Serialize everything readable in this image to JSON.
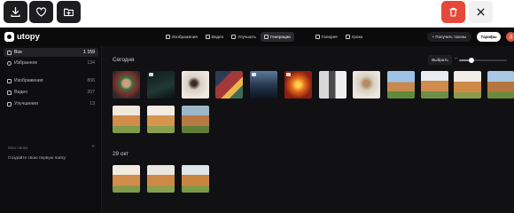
{
  "toolbar": {
    "buttons": [
      {
        "name": "download-button",
        "icon": "download-icon"
      },
      {
        "name": "favorite-button",
        "icon": "heart-icon"
      },
      {
        "name": "add-to-folder-button",
        "icon": "folder-plus-icon"
      },
      {
        "name": "delete-button",
        "icon": "trash-icon"
      },
      {
        "name": "close-button",
        "icon": "close-icon"
      }
    ]
  },
  "header": {
    "logo": "utopy",
    "nav": [
      {
        "label": "Изображения",
        "icon": "image-icon",
        "active": false
      },
      {
        "label": "Видео",
        "icon": "video-icon",
        "active": false
      },
      {
        "label": "Улучшить",
        "icon": "wand-icon",
        "active": false
      },
      {
        "label": "Генерации",
        "icon": "generations-icon",
        "active": true
      }
    ],
    "nav2": [
      {
        "label": "Галерея",
        "icon": "gallery-icon"
      },
      {
        "label": "Уроки",
        "icon": "lessons-icon"
      }
    ],
    "tokens_label": "+ Получить токены",
    "tariffs_label": "Тарифы",
    "avatar_letter": "Д"
  },
  "sidebar": {
    "items": [
      {
        "label": "Все",
        "count": "1 159",
        "icon": "grid-icon",
        "active": true
      },
      {
        "label": "Избранное",
        "count": "134",
        "icon": "heart-icon",
        "active": false
      },
      {
        "label": "Изображения",
        "count": "806",
        "icon": "image-icon",
        "active": false
      },
      {
        "label": "Видео",
        "count": "207",
        "icon": "video-icon",
        "active": false
      },
      {
        "label": "Улучшения",
        "count": "13",
        "icon": "wand-icon",
        "active": false
      }
    ],
    "folders_heading": "Мои папки",
    "create_folder": "Создайте свою первую папку"
  },
  "main": {
    "sections": [
      {
        "title": "Сегодня",
        "thumb_count": 14
      },
      {
        "title": "29 окт",
        "thumb_count": 3
      }
    ],
    "select_label": "Выбрать",
    "zoom_level": 0.25
  }
}
